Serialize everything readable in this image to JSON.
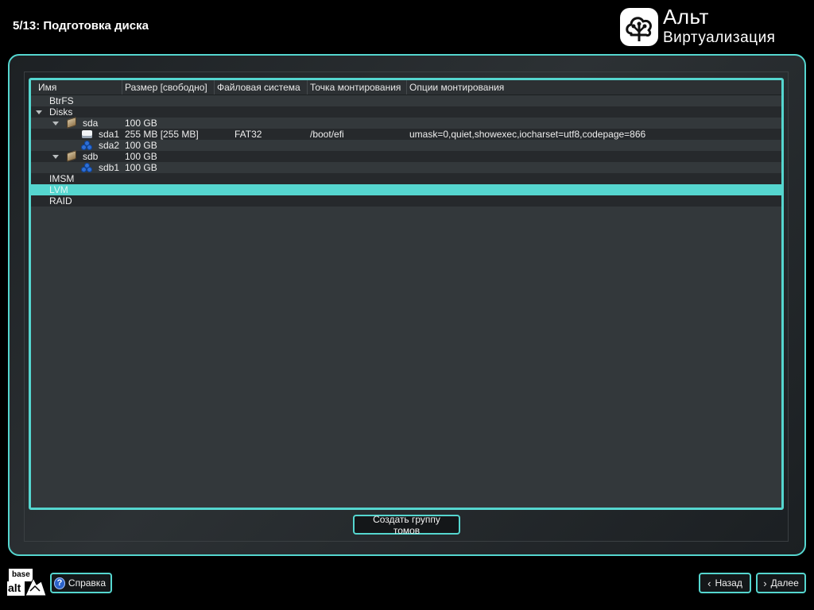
{
  "step_title": "5/13: Подготовка диска",
  "logo": {
    "line1": "Альт",
    "line2": "Виртуализация"
  },
  "tree": {
    "columns": [
      "Имя",
      "Размер [свободно]",
      "Файловая система",
      "Точка монтирования",
      "Опции монтирования"
    ],
    "rows": [
      {
        "name": "BtrFS",
        "size": "",
        "fs": "",
        "mount": "",
        "options": ""
      },
      {
        "name": "Disks",
        "size": "",
        "fs": "",
        "mount": "",
        "options": ""
      },
      {
        "name": "sda",
        "size": "100 GB",
        "fs": "",
        "mount": "",
        "options": ""
      },
      {
        "name": "sda1",
        "size": "255 MB [255 MB]",
        "fs": "FAT32",
        "mount": "/boot/efi",
        "options": "umask=0,quiet,showexec,iocharset=utf8,codepage=866"
      },
      {
        "name": "sda2",
        "size": "100 GB",
        "fs": "",
        "mount": "",
        "options": ""
      },
      {
        "name": "sdb",
        "size": "100 GB",
        "fs": "",
        "mount": "",
        "options": ""
      },
      {
        "name": "sdb1",
        "size": "100 GB",
        "fs": "",
        "mount": "",
        "options": ""
      },
      {
        "name": "IMSM",
        "size": "",
        "fs": "",
        "mount": "",
        "options": ""
      },
      {
        "name": "LVM",
        "size": "",
        "fs": "",
        "mount": "",
        "options": ""
      },
      {
        "name": "RAID",
        "size": "",
        "fs": "",
        "mount": "",
        "options": ""
      }
    ],
    "selected": "LVM"
  },
  "buttons": {
    "create_group": "Создать группу томов",
    "help": "Справка",
    "back": "Назад",
    "next": "Далее"
  },
  "footer_logo": {
    "line1": "base",
    "line2": "alt"
  },
  "icons": {
    "disk": "hard-disk-icon",
    "partition_efi": "partition-white-icon",
    "partition": "partition-blue-icon",
    "help": "help-icon"
  },
  "colors": {
    "accent": "#55d6cf",
    "background": "#000000",
    "tree_bg": "#33383b"
  }
}
